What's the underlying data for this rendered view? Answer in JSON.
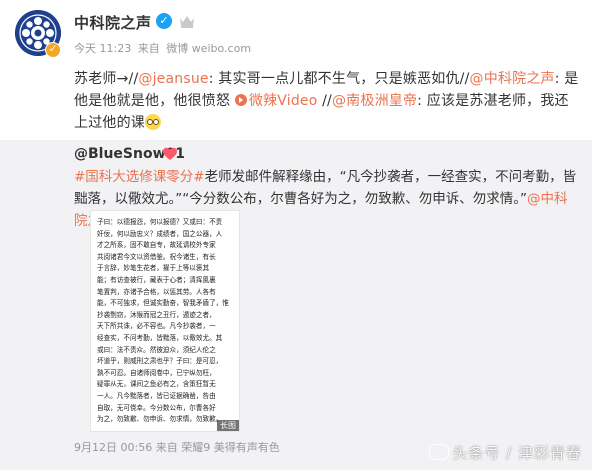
{
  "post": {
    "author": "中科院之声",
    "time": "今天 11:23",
    "source_prefix": "来自",
    "source": "微博 weibo.com",
    "body": {
      "seg1": "苏老师→//",
      "mention1": "@jeansue",
      "seg2": ": 其实哥一点儿都不生气，只是嫉恶如仇//",
      "mention2": "@中科院之声",
      "seg3": ": 是他是他就是他，他很愤怒 ",
      "video_label": "微辣Video",
      "seg4": " //",
      "mention3": "@南极洲皇帝",
      "seg5": ": 应该是苏湛老师，我还上过他的课"
    }
  },
  "repost": {
    "user": "@BlueSnow01",
    "tag": "#国科大选修课零分#",
    "text1": "老师发邮件解释缘由，“凡今抄袭者，一经查实，不问考勤，皆黜落，以儆效尤。”“今分数公布，尔曹各好为之，勿致歉、勿申诉、勿求情。”",
    "mention": "@中科院之声",
    "time": "9月12日 00:56",
    "source_prefix": "来自",
    "source": "荣耀9 美得有声有色",
    "image_tag": "长图",
    "image_lines": [
      "子曰：以德报怨，何以报德？又或曰：不责",
      "奸佞，何以励忠义？成绩者，国之公器，人",
      "才之所系，固不敢自专，故延请校外专家",
      "共阅诸君今文以资借鉴。祝今诸生，有长",
      "于言辞，妙笔生花者，擢于上等以褒其",
      "能；有访查被行，藏表于心者；清挥風裏",
      "笔置判，亦诸予合格，以惩其劳。人各有",
      "能，不可独求，但诚实勤奋，智我矛盾了，惟",
      "抄袭剽窃，沐猴而冠之丑行，遁迹之者，",
      "天下所共诛，必不容也。凡今抄袭者，一",
      "经查实，不问考勤，皆黜落，以儆效尤。其",
      "或曰：法不责众。然彼迫众，须纪人伦之",
      "坏道乎，则威刑之肃也乎？子曰：是可忍，",
      "孰不可忍。自诸师阅卷中，已宁纵勿枉，",
      "疑罪从无，课间之鱼必有之，含策狂暂无",
      "一人。凡今黜落者，皆已证据确凿，咎由",
      "自取，无可侥幸。今分数公布，尔曹各好",
      "为之，勿致歉、勿申诉、勿求情，勿致歉。"
    ]
  },
  "watermark": "头条号 / 津彩青春",
  "colors": {
    "link": "#eb7350",
    "repost_bg": "#f2f2f5",
    "meta": "#999999"
  }
}
